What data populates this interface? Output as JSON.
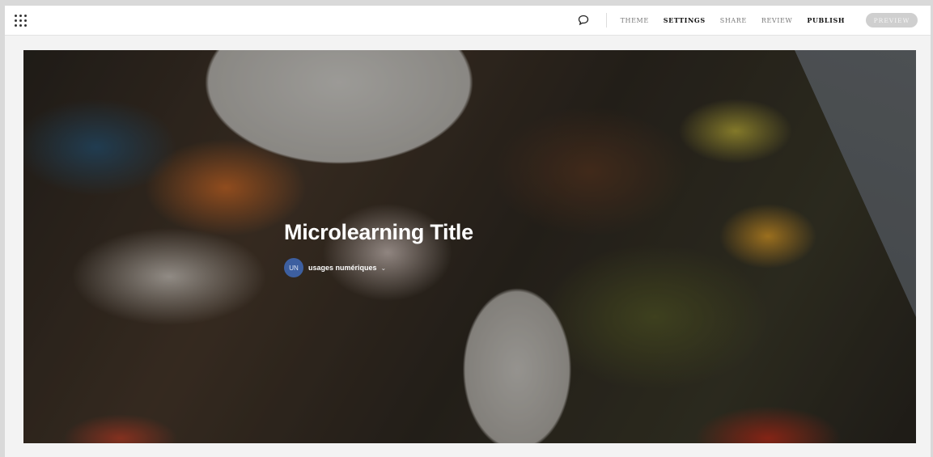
{
  "toolbar": {
    "nav": [
      {
        "label": "THEME",
        "state": "default"
      },
      {
        "label": "SETTINGS",
        "state": "active"
      },
      {
        "label": "SHARE",
        "state": "default"
      },
      {
        "label": "REVIEW",
        "state": "default"
      },
      {
        "label": "PUBLISH",
        "state": "emphasis"
      }
    ],
    "preview_label": "PREVIEW",
    "icons": {
      "apps": "apps-grid-icon",
      "comment": "comment-icon"
    }
  },
  "hero": {
    "title": "Microlearning Title",
    "author": {
      "initials": "UN",
      "name": "usages numériques",
      "caret": "⌄"
    }
  },
  "colors": {
    "avatar_bg": "#3d5fa0",
    "preview_bg": "#cfcfcf",
    "title_text": "#ffffff"
  }
}
